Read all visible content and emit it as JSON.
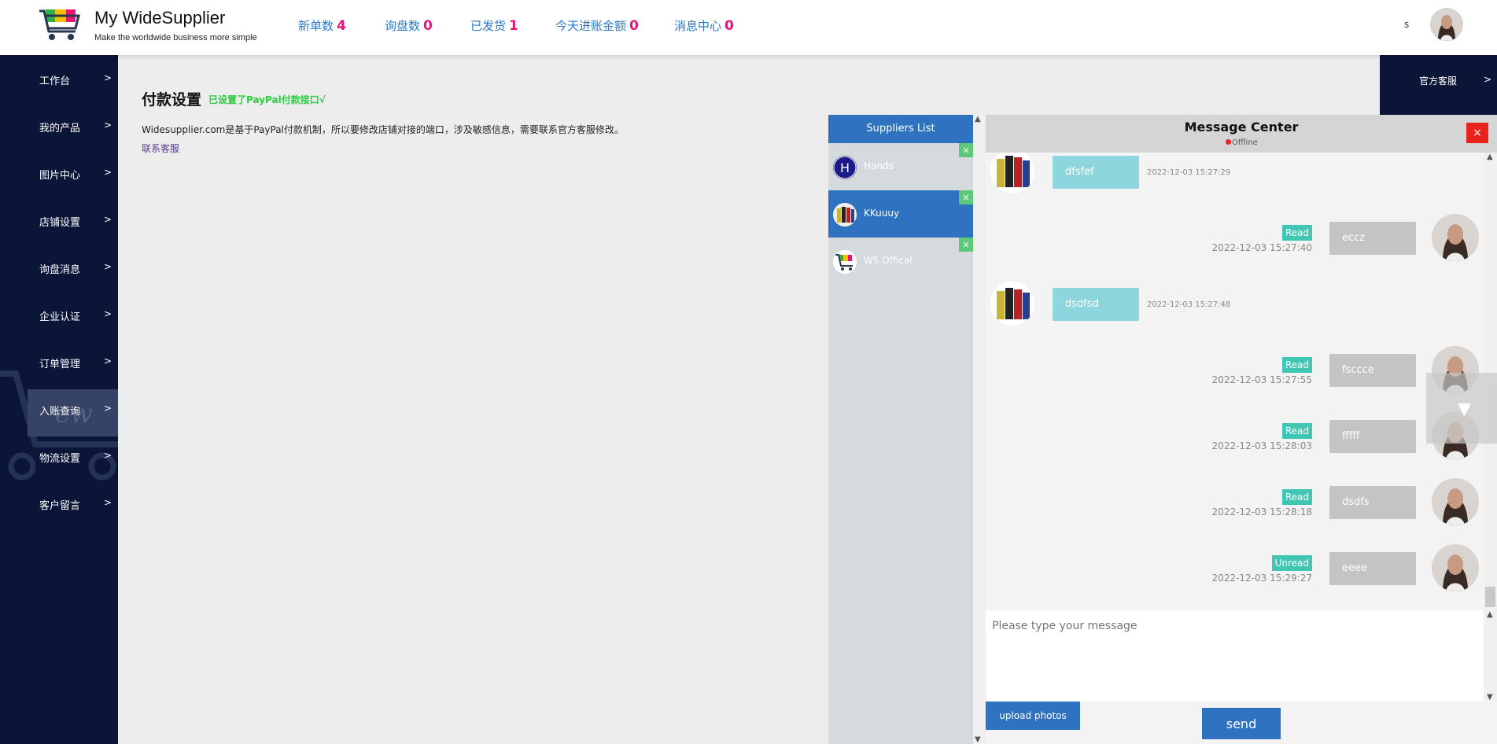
{
  "header": {
    "brand_title": "My WideSupplier",
    "brand_subtitle": "Make the worldwide business more simple",
    "stats": [
      {
        "label": "新单数",
        "value": "4"
      },
      {
        "label": "询盘数",
        "value": "0"
      },
      {
        "label": "已发货",
        "value": "1"
      },
      {
        "label": "今天进账金额",
        "value": "0"
      },
      {
        "label": "消息中心",
        "value": "0"
      }
    ],
    "user_initial": "s"
  },
  "sidebar": {
    "items": [
      {
        "label": "工作台",
        "arrow": ">"
      },
      {
        "label": "我的产品",
        "arrow": ">"
      },
      {
        "label": "图片中心",
        "arrow": ">"
      },
      {
        "label": "店铺设置",
        "arrow": ">"
      },
      {
        "label": "询盘消息",
        "arrow": ">"
      },
      {
        "label": "企业认证",
        "arrow": ">"
      },
      {
        "label": "订单管理",
        "arrow": ">"
      },
      {
        "label": "入账查询",
        "arrow": ">"
      },
      {
        "label": "物流设置",
        "arrow": ">"
      },
      {
        "label": "客户留言",
        "arrow": ">"
      }
    ]
  },
  "right_rail": {
    "label": "官方客服",
    "arrow": ">"
  },
  "main": {
    "title": "付款设置",
    "badge": "已设置了PayPal付款接口√",
    "description": "Widesupplier.com是基于PayPal付款机制，所以要修改店铺对接的端口，涉及敏感信息，需要联系官方客服修改。",
    "link": "联系客服"
  },
  "suppliers": {
    "header": "Suppliers List",
    "items": [
      {
        "name": "Hands",
        "avatar_letter": "H",
        "active": false,
        "close": "×"
      },
      {
        "name": "KKuuuy",
        "active": true,
        "close": "×"
      },
      {
        "name": "WS Offical",
        "active": false,
        "close": "×"
      }
    ]
  },
  "message_center": {
    "title": "Message Center",
    "status": "Offline",
    "close": "×",
    "messages": [
      {
        "dir": "in",
        "text": "dfsfef",
        "time": "2022-12-03 15:27:29"
      },
      {
        "dir": "out",
        "text": "eccz",
        "time": "2022-12-03 15:27:40",
        "status": "Read"
      },
      {
        "dir": "in",
        "text": "dsdfsd",
        "time": "2022-12-03 15:27:48"
      },
      {
        "dir": "out",
        "text": "fsccce",
        "time": "2022-12-03 15:27:55",
        "status": "Read"
      },
      {
        "dir": "out",
        "text": "fffff",
        "time": "2022-12-03 15:28:03",
        "status": "Read"
      },
      {
        "dir": "out",
        "text": "dsdfs",
        "time": "2022-12-03 15:28:18",
        "status": "Read"
      },
      {
        "dir": "out",
        "text": "eeee",
        "time": "2022-12-03 15:29:27",
        "status": "Unread"
      }
    ],
    "input_placeholder": "Please type your message",
    "upload_label": "upload photos",
    "send_label": "send"
  },
  "colors": {
    "sidebar_bg": "#0b1538",
    "accent_blue": "#2f72bf",
    "stat_number": "#e6157a",
    "read_badge": "#3fc7b4",
    "close_red": "#e8221d",
    "success_green": "#2ecc40"
  }
}
